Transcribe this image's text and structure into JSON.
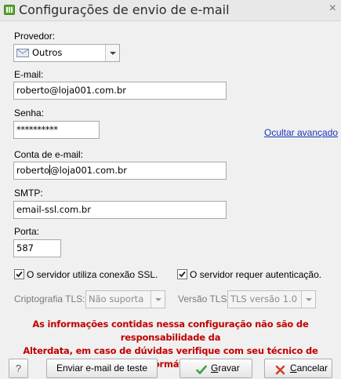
{
  "window": {
    "title": "Configurações de envio de e-mail",
    "close_glyph": "×"
  },
  "provider": {
    "label": "Provedor:",
    "selected": "Outros",
    "icon": "envelope-icon"
  },
  "email": {
    "label": "E-mail:",
    "value": "roberto@loja001.com.br"
  },
  "password": {
    "label": "Senha:",
    "value": "**********"
  },
  "advanced_link": "Ocultar avançado",
  "account": {
    "label": "Conta de e-mail:",
    "value_before_caret": "roberto",
    "value_after_caret": "@loja001.com.br"
  },
  "smtp": {
    "label": "SMTP:",
    "value": "email-ssl.com.br"
  },
  "port": {
    "label": "Porta:",
    "value": "587"
  },
  "ssl_checkbox": {
    "label": "O servidor utiliza conexão SSL.",
    "checked": true
  },
  "auth_checkbox": {
    "label": "O servidor requer autenticação.",
    "checked": true
  },
  "tls_crypto": {
    "label": "Criptografia TLS:",
    "selected": "Não suporta"
  },
  "tls_version": {
    "label": "Versão TLS:",
    "selected": "TLS versão 1.0"
  },
  "warning": {
    "line1": "As informações contidas nessa configuração não são de responsabilidade da",
    "line2": "Alterdata, em caso de dúvidas verifique com seu técnico de informática."
  },
  "buttons": {
    "help": "?",
    "test": "Enviar e-mail de teste",
    "save": "Gravar",
    "cancel": "Cancelar"
  },
  "colors": {
    "warning_text": "#c00000",
    "link": "#1a37b8",
    "save_check": "#3aa33a",
    "cancel_x": "#d23a2a",
    "title_icon": "#5aa830"
  }
}
